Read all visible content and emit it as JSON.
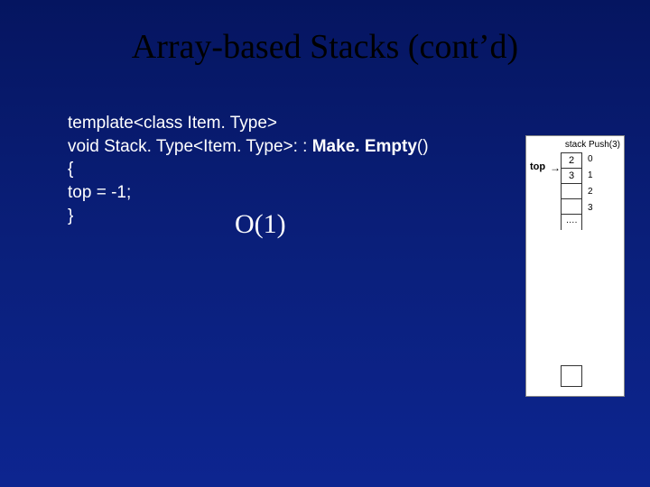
{
  "title": "Array-based Stacks (cont’d)",
  "code": {
    "line1_a": "template<class Item. Type>",
    "line2_a": "void Stack. Type<Item. Type>: : ",
    "line2_b": "Make. Empty",
    "line2_c": "()",
    "line3": "{",
    "line4": " top = -1;",
    "line5": "}"
  },
  "complexity": "O(1)",
  "diagram": {
    "caption": "stack Push(3)",
    "top_label": "top",
    "arrow": "→",
    "cells": [
      "2",
      "3",
      "",
      ""
    ],
    "indices": [
      "0",
      "1",
      "2",
      "3"
    ],
    "ellipsis": "…."
  }
}
